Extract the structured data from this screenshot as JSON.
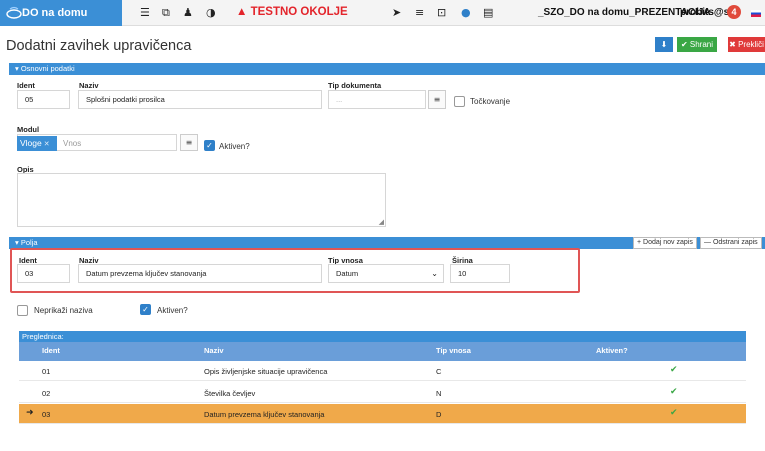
{
  "nav": {
    "brand": "DO na domu",
    "warning_icon": "warning-triangle-icon",
    "warning": "TESTNO OKOLJE",
    "environment": "_SZO_DO na domu_PREZENTACIJA",
    "user": "probits@szo",
    "notification_count": "4",
    "icons": [
      "list-icon",
      "external-link-icon",
      "bell-icon",
      "contrast-icon",
      "send-icon",
      "list-icon",
      "screen-icon",
      "info-icon",
      "document-icon"
    ]
  },
  "page": {
    "title": "Dodatni zavihek upravičenca",
    "buttons": {
      "download_icon": "download-icon",
      "save": "✔ Shrani",
      "cancel": "✖ Prekliči"
    }
  },
  "osnovni": {
    "section": "▾ Osnovni podatki",
    "ident_label": "Ident",
    "ident_value": "05",
    "naziv_label": "Naziv",
    "naziv_value": "Splošni podatki prosilca",
    "tip_label": "Tip dokumenta",
    "tip_placeholder": "...",
    "tockovanje": "Točkovanje",
    "modul_label": "Modul",
    "modul_tag": "Vloge",
    "modul_placeholder": "Vnos",
    "aktiven": "Aktiven?",
    "opis_label": "Opis"
  },
  "polja": {
    "section": "▾ Polja",
    "add": "+ Dodaj nov zapis",
    "remove": "— Odstrani zapis",
    "ident_label": "Ident",
    "ident_value": "03",
    "naziv_label": "Naziv",
    "naziv_value": "Datum prevzema ključev stanovanja",
    "tip_label": "Tip vnosa",
    "tip_value": "Datum",
    "sirina_label": "Širina",
    "sirina_value": "10",
    "neprikazi": "Neprikaži naziva",
    "aktiven": "Aktiven?"
  },
  "grid": {
    "title": "Preglednica:",
    "columns": [
      "Ident",
      "Naziv",
      "Tip vnosa",
      "Aktiven?"
    ],
    "rows": [
      {
        "ident": "01",
        "naziv": "Opis življenjske situacije upravičenca",
        "tip": "C",
        "aktiven": "✔"
      },
      {
        "ident": "02",
        "naziv": "Številka čevljev",
        "tip": "N",
        "aktiven": "✔"
      },
      {
        "ident": "03",
        "naziv": "Datum prevzema ključev stanovanja",
        "tip": "D",
        "aktiven": "✔"
      }
    ]
  },
  "colors": {
    "accent": "#3b8fd6",
    "save": "#3aa745",
    "cancel": "#e03a3a",
    "selected_row": "#f0a94a",
    "warning": "#e3242b"
  }
}
